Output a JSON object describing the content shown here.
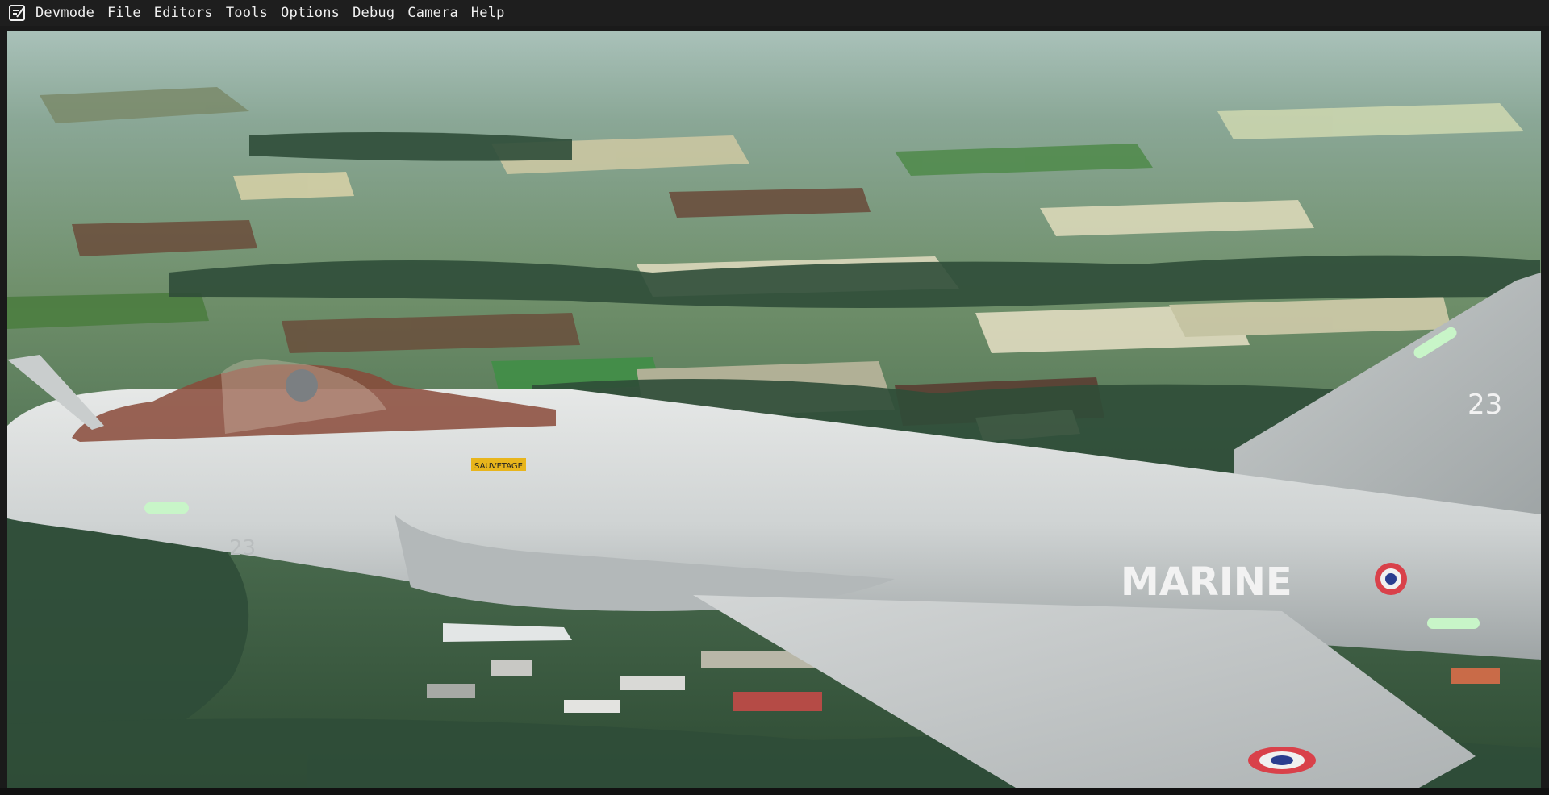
{
  "menubar": {
    "app_icon": "devmode-notepad-icon",
    "items": [
      "Devmode",
      "File",
      "Editors",
      "Tools",
      "Options",
      "Debug",
      "Camera",
      "Help"
    ]
  },
  "scene": {
    "aircraft_labels": {
      "fin_number": "23",
      "nose_number": "23",
      "fuselage_text": "MARINE",
      "rescue_label": "SAUVETAGE"
    },
    "colors": {
      "sky_haze": "#a9c1b9",
      "fields_green": "#4f8a4a",
      "forest": "#2c4a34",
      "aircraft_grey": "#cfd3d3",
      "canopy": "#8a4a3a",
      "rescue_yellow": "#e8b51c"
    }
  }
}
